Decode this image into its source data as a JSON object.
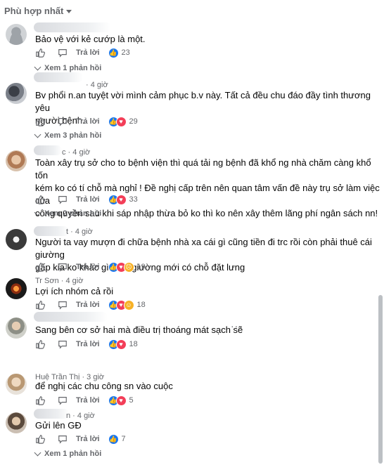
{
  "sort_label": "Phù hợp nhất",
  "reply_label": "Trả lời",
  "comments": [
    {
      "time": "",
      "text": [
        "Bảo vệ với kẻ cướp là một."
      ],
      "reactions": [
        "like"
      ],
      "count": "23",
      "replies": "Xem 1 phản hồi"
    },
    {
      "time": "· 4 giờ",
      "text": [
        "Bv phổi n.an tuyệt vời mình cảm phục b.v này. Tất cả đều chu đáo đầy tình thương yêu",
        "người bệnh."
      ],
      "reactions": [
        "like",
        "love"
      ],
      "count": "29",
      "replies": "Xem 3 phản hồi"
    },
    {
      "time": "c · 4 giờ",
      "text": [
        "Toàn xây trụ sở cho to bệnh viện thì quá tải ng bệnh đã khổ ng nhà chăm càng khổ tốn",
        "kém ko có tí chỗ mà nghỉ ! Đề nghị cấp trên nên quan tâm vấn đề này trụ sở làm việc của",
        "công quyền sau khi sáp nhập thừa bỏ ko thì ko nên xây thêm lãng phí ngân sách nn!"
      ],
      "reactions": [
        "like",
        "love"
      ],
      "count": "33",
      "replies": "Xem 2 phản hồi"
    },
    {
      "time": "t · 4 giờ",
      "text": [
        "Người ta vay mượn đi chữa bệnh nhà xa cái gì cũng tiền đi trc rồi còn phải thuê cái giường",
        "gấp kia ko khác gì mua giường mới có chỗ đặt lưng"
      ],
      "reactions": [
        "like",
        "love",
        "sad"
      ],
      "count": "19",
      "replies": ""
    },
    {
      "time": "Tr Sơn · 4 giờ",
      "text": [
        "Lợi ích nhóm cả rồi"
      ],
      "reactions": [
        "like",
        "love",
        "haha"
      ],
      "count": "18",
      "replies": ""
    },
    {
      "time": "",
      "text": [
        "Sang bên cơ sở hai mà điều trị thoáng mát sạch sẽ"
      ],
      "reactions": [
        "like",
        "love"
      ],
      "count": "18",
      "replies": "",
      "more": "···"
    },
    {
      "time": "Huệ Trần Thị · 3 giờ",
      "text": [
        "để nghị các chu công sn vào cuộc"
      ],
      "reactions": [
        "like",
        "love"
      ],
      "count": "5",
      "replies": ""
    },
    {
      "time": "n · 4 giờ",
      "text": [
        "Gửi lên GĐ"
      ],
      "reactions": [
        "like"
      ],
      "count": "7",
      "replies": "Xem 1 phản hồi"
    }
  ],
  "icons": {
    "like": "thumbs-up-icon",
    "reply": "chat-bubble-icon"
  },
  "colors": {
    "like": "#1877f2",
    "love": "#f33e58",
    "haha": "#f7b125",
    "sad": "#f7b125"
  }
}
